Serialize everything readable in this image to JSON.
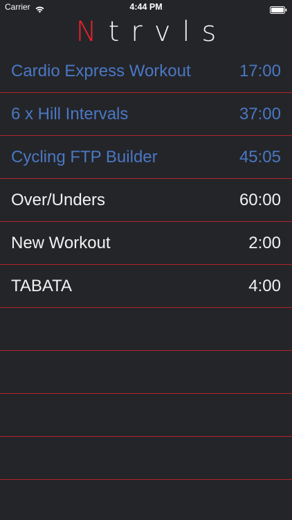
{
  "status_bar": {
    "carrier": "Carrier",
    "time": "4:44 PM",
    "wifi_icon": "wifi-icon",
    "battery_icon": "battery-icon"
  },
  "header": {
    "title_first": "N",
    "title_rest": "trvls",
    "accent_color": "#e8212b"
  },
  "workouts": [
    {
      "name": "Cardio Express Workout",
      "duration": "17:00",
      "style": "featured"
    },
    {
      "name": "6 x Hill Intervals",
      "duration": "37:00",
      "style": "featured"
    },
    {
      "name": "Cycling FTP Builder",
      "duration": "45:05",
      "style": "featured"
    },
    {
      "name": "Over/Unders",
      "duration": "60:00",
      "style": "custom"
    },
    {
      "name": "New Workout",
      "duration": "2:00",
      "style": "custom"
    },
    {
      "name": "TABATA",
      "duration": "4:00",
      "style": "custom"
    }
  ],
  "colors": {
    "background": "#242529",
    "featured_text": "#4a78c4",
    "custom_text": "#f2f2f2",
    "separator": "#b1242c"
  }
}
